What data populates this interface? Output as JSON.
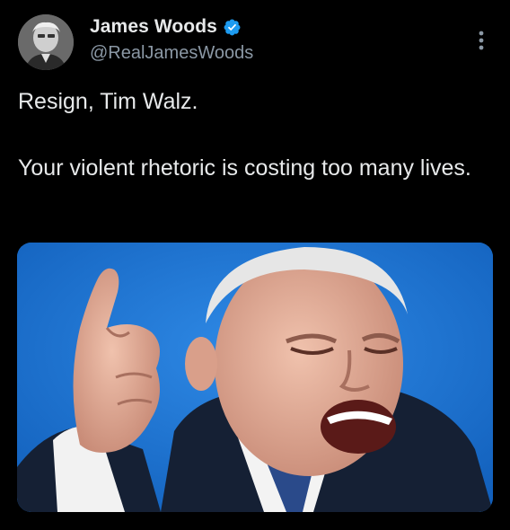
{
  "author": {
    "display_name": "James Woods",
    "handle": "@RealJamesWoods",
    "verified": true,
    "avatar": "avatar-photo-grayscale"
  },
  "tweet": {
    "paragraph_1": "Resign, Tim Walz.",
    "paragraph_2": "Your violent rhetoric is costing too many lives."
  },
  "media": {
    "description_icon": "photo"
  },
  "icons": {
    "verified": "verified-badge-icon",
    "more": "more-options-icon"
  },
  "colors": {
    "background": "#000000",
    "text": "#e7e9ea",
    "secondary_text": "#8b98a5",
    "verified_badge": "#1d9bf0",
    "photo_backdrop": "#1d74d0"
  }
}
